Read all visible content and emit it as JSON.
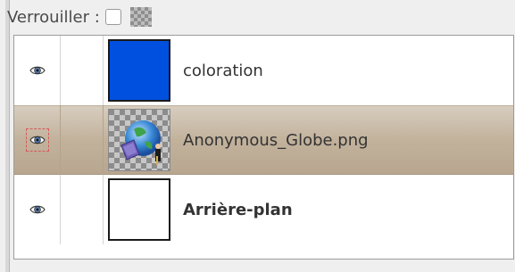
{
  "lock_bar": {
    "label": "Verrouiller :",
    "pixels_lock_checked": false,
    "alpha_lock_icon": "checkerboard-icon"
  },
  "layers": [
    {
      "name": "coloration",
      "visible": true,
      "selected": false,
      "bold": false,
      "thumbnail": "solid-blue",
      "thumbnail_color": "#0050e0",
      "eye_icon": "eye-icon"
    },
    {
      "name": "Anonymous_Globe.png",
      "visible": true,
      "selected": true,
      "bold": false,
      "thumbnail": "globe-image",
      "eye_icon": "eye-icon"
    },
    {
      "name": "Arrière-plan",
      "visible": true,
      "selected": false,
      "bold": true,
      "thumbnail": "solid-white",
      "thumbnail_color": "#ffffff",
      "eye_icon": "eye-icon"
    }
  ],
  "colors": {
    "selection": "#c2b29c",
    "panel_bg": "#efefef",
    "list_bg": "#ffffff",
    "text": "#333333"
  }
}
